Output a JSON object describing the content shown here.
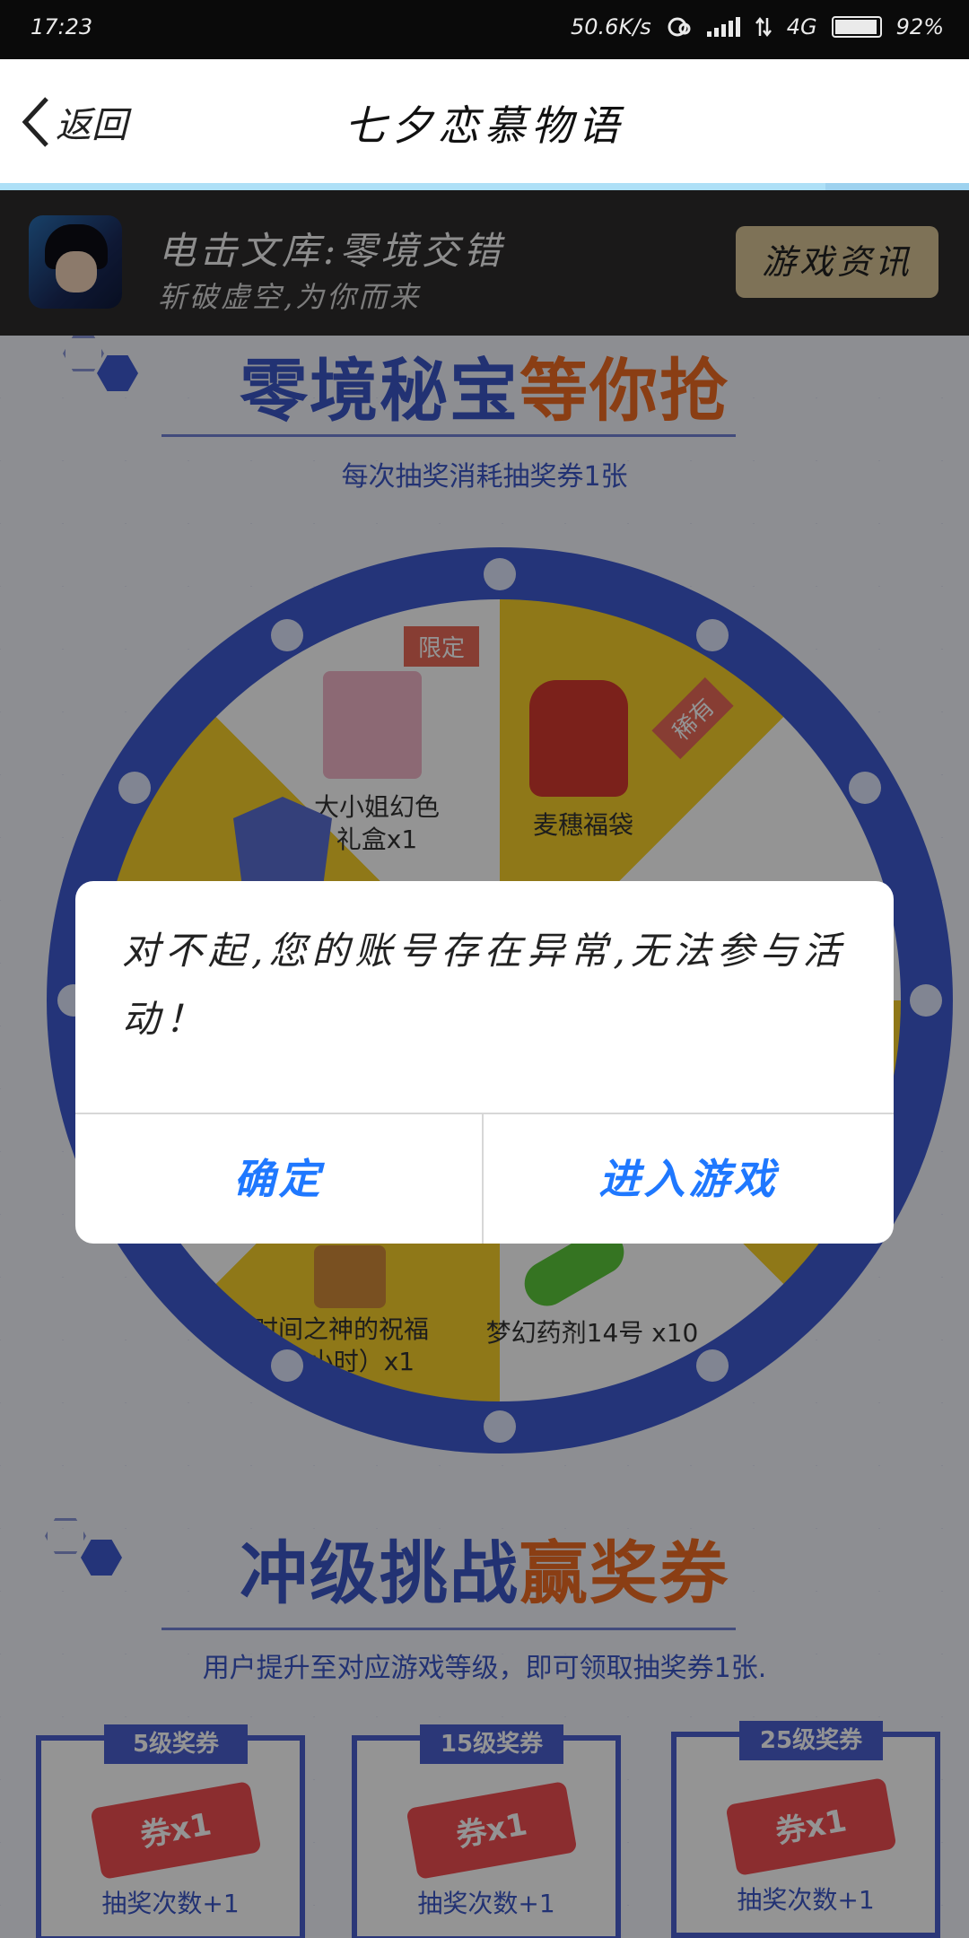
{
  "status_bar": {
    "time": "17:23",
    "net_speed": "50.6K/s",
    "network_type": "4G",
    "battery": "92%"
  },
  "nav": {
    "back_label": "返回",
    "title": "七夕恋慕物语"
  },
  "game_header": {
    "name": "电击文库:零境交错",
    "subtitle": "斩破虚空,为你而来",
    "info_button": "游戏资讯"
  },
  "lottery_section": {
    "title_blue": "零境秘宝",
    "title_orange": "等你抢",
    "subtitle": "每次抽奖消耗抽奖券1张",
    "prizes": [
      {
        "label_line1": "大小姐幻色",
        "label_line2": "礼盒x1",
        "tag": "限定"
      },
      {
        "label_line1": "麦穗福袋",
        "label_line2": "",
        "tag": "稀有"
      },
      {
        "label_line1": "时间之神的祝福",
        "label_line2": "（1小时）x1",
        "tag": ""
      },
      {
        "label_line1": "梦幻药剂14号 x10",
        "label_line2": "",
        "tag": ""
      }
    ]
  },
  "upgrade_section": {
    "title_blue": "冲级挑战",
    "title_orange": "赢奖券",
    "subtitle": "用户提升至对应游戏等级，即可领取抽奖券1张.",
    "tickets": [
      {
        "header": "5级奖券",
        "stamp": "券x1",
        "label": "抽奖次数+1"
      },
      {
        "header": "15级奖券",
        "stamp": "券x1",
        "label": "抽奖次数+1"
      },
      {
        "header": "25级奖券",
        "stamp": "券x1",
        "label": "抽奖次数+1"
      }
    ]
  },
  "dialog": {
    "message": "对不起,您的账号存在异常,无法参与活动！",
    "confirm_label": "确定",
    "enter_game_label": "进入游戏"
  },
  "colors": {
    "accent_blue": "#1f78ff",
    "brand_blue": "#3f5bd0",
    "brand_orange": "#ee6b24",
    "gold_button": "#d9c596"
  }
}
